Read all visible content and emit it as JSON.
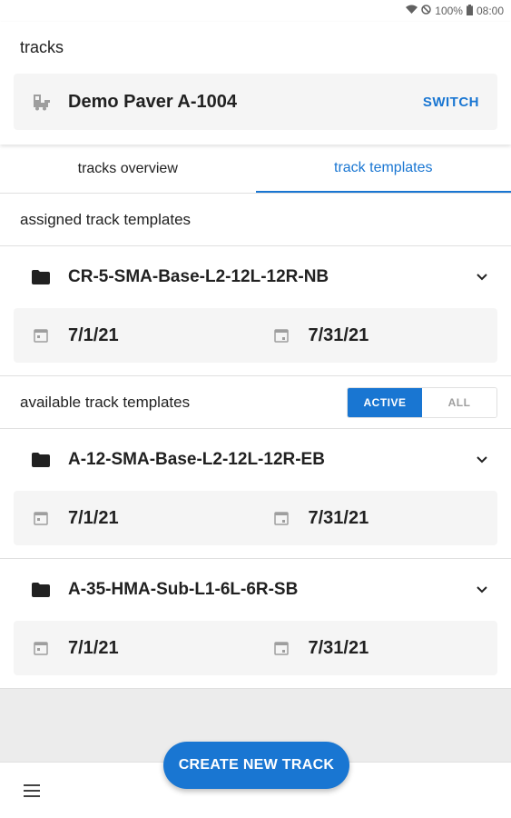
{
  "status_bar": {
    "battery_pct": "100%",
    "time": "08:00"
  },
  "header": {
    "title": "tracks",
    "machine_name": "Demo Paver A-1004",
    "switch_label": "SWITCH"
  },
  "tabs": [
    {
      "label": "tracks overview",
      "active": false
    },
    {
      "label": "track templates",
      "active": true
    }
  ],
  "assigned": {
    "heading": "assigned track templates",
    "items": [
      {
        "name": "CR-5-SMA-Base-L2-12L-12R-NB",
        "start": "7/1/21",
        "end": "7/31/21"
      }
    ]
  },
  "available": {
    "heading": "available track templates",
    "filter": {
      "active_label": "ACTIVE",
      "all_label": "ALL",
      "selected": "ACTIVE"
    },
    "items": [
      {
        "name": "A-12-SMA-Base-L2-12L-12R-EB",
        "start": "7/1/21",
        "end": "7/31/21"
      },
      {
        "name": "A-35-HMA-Sub-L1-6L-6R-SB",
        "start": "7/1/21",
        "end": "7/31/21"
      }
    ]
  },
  "fab": {
    "label": "CREATE NEW TRACK"
  },
  "colors": {
    "accent": "#1976d2",
    "card_bg": "#f5f5f5",
    "page_bg": "#ececec"
  },
  "icons": {
    "machine": "paver-icon",
    "folder": "folder-icon",
    "chevron": "chevron-down-icon",
    "calendar": "calendar-icon",
    "menu": "hamburger-menu-icon"
  }
}
